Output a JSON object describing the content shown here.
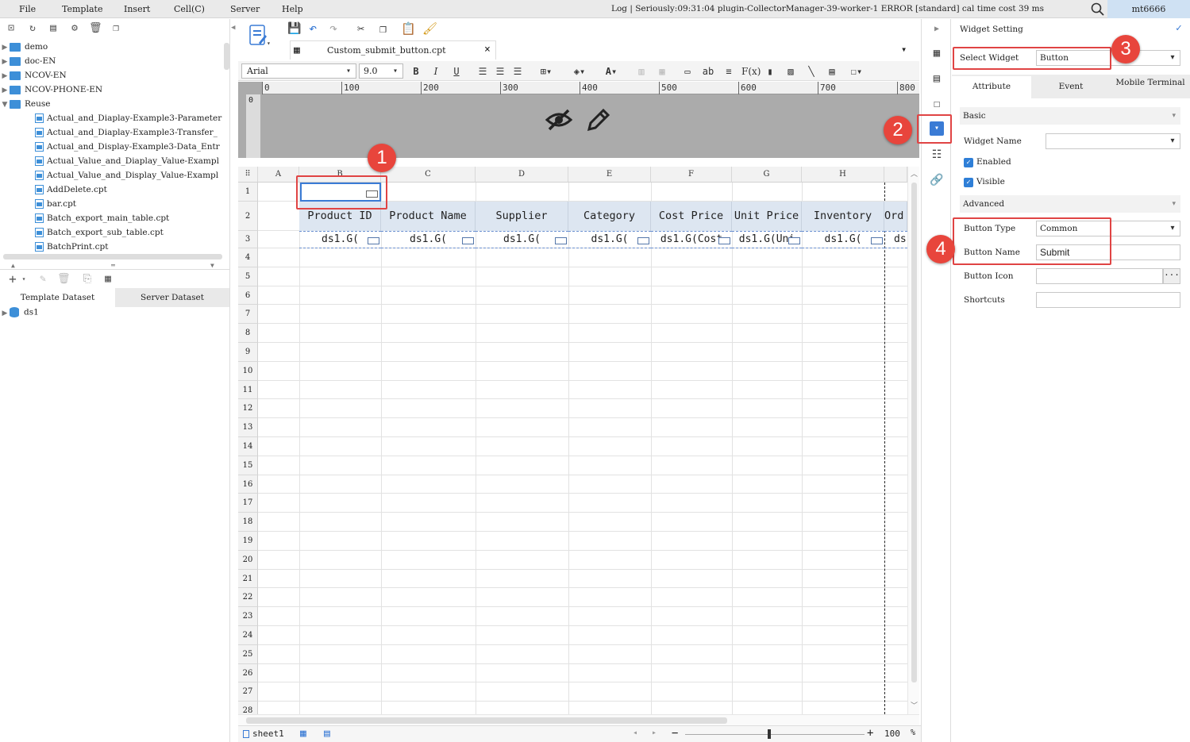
{
  "menubar": {
    "items": [
      "File",
      "Template",
      "Insert",
      "Cell(C)",
      "Server",
      "Help"
    ],
    "log_message": "Log | Seriously:09:31:04 plugin-CollectorManager-39-worker-1 ERROR [standard] cal time cost 39 ms",
    "user": "mt6666"
  },
  "tree": {
    "folders": [
      "demo",
      "doc-EN",
      "NCOV-EN",
      "NCOV-PHONE-EN",
      "Reuse"
    ],
    "files": [
      "Actual_and_Diaplay-Example3-Parameter",
      "Actual_and_Diaplay-Example3-Transfer_",
      "Actual_and_Display-Example3-Data_Entr",
      "Actual_Value_and_Diaplay_Value-Exampl",
      "Actual_Value_and_Display_Value-Exampl",
      "AddDelete.cpt",
      "bar.cpt",
      "Batch_export_main_table.cpt",
      "Batch_export_sub_table.cpt",
      "BatchPrint.cpt"
    ]
  },
  "dataset": {
    "tabs": [
      "Template Dataset",
      "Server Dataset"
    ],
    "items": [
      "ds1"
    ]
  },
  "editor": {
    "doc_tab": "Custom_submit_button.cpt",
    "font_name": "Arial",
    "font_size": "9.0",
    "ruler_ticks": [
      "0",
      "100",
      "200",
      "300",
      "400",
      "500",
      "600",
      "700",
      "800"
    ],
    "vruler_label": "0"
  },
  "grid": {
    "columns": [
      "A",
      "B",
      "C",
      "D",
      "E",
      "F",
      "G",
      "H"
    ],
    "rows": [
      "1",
      "2",
      "3",
      "4",
      "5",
      "6",
      "7",
      "8",
      "9",
      "10",
      "11",
      "12",
      "13",
      "14",
      "15",
      "16",
      "17",
      "18",
      "19",
      "20",
      "21",
      "22",
      "23",
      "24",
      "25",
      "26",
      "27",
      "28"
    ],
    "headers": [
      "Product ID",
      "Product Name",
      "Supplier",
      "Category",
      "Cost Price",
      "Unit Price",
      "Inventory",
      "Ord"
    ],
    "data_cells": [
      "ds1.G(",
      "ds1.G(",
      "ds1.G(",
      "ds1.G(",
      "ds1.G(Cost",
      "ds1.G(Uni",
      "ds1.G(",
      "ds"
    ]
  },
  "footer": {
    "sheet": "sheet1",
    "zoom_value": "100",
    "zoom_unit": "%",
    "zoom_minus": "−",
    "zoom_plus": "+"
  },
  "widget_panel": {
    "title": "Widget Setting",
    "select_widget_label": "Select Widget",
    "select_widget_value": "Button",
    "tabs": [
      "Attribute",
      "Event",
      "Mobile Terminal"
    ],
    "basic_label": "Basic",
    "widget_name_label": "Widget Name",
    "widget_name_value": "",
    "enabled_label": "Enabled",
    "visible_label": "Visible",
    "advanced_label": "Advanced",
    "button_type_label": "Button Type",
    "button_type_value": "Common",
    "button_name_label": "Button Name",
    "button_name_value": "Submit",
    "button_icon_label": "Button Icon",
    "button_icon_value": "",
    "shortcuts_label": "Shortcuts",
    "shortcuts_value": ""
  },
  "annotations": [
    "1",
    "2",
    "3",
    "4"
  ],
  "colors": {
    "annotation": "#e8453c",
    "accent": "#2f7fd7",
    "header_fill": "#dde6f1"
  }
}
